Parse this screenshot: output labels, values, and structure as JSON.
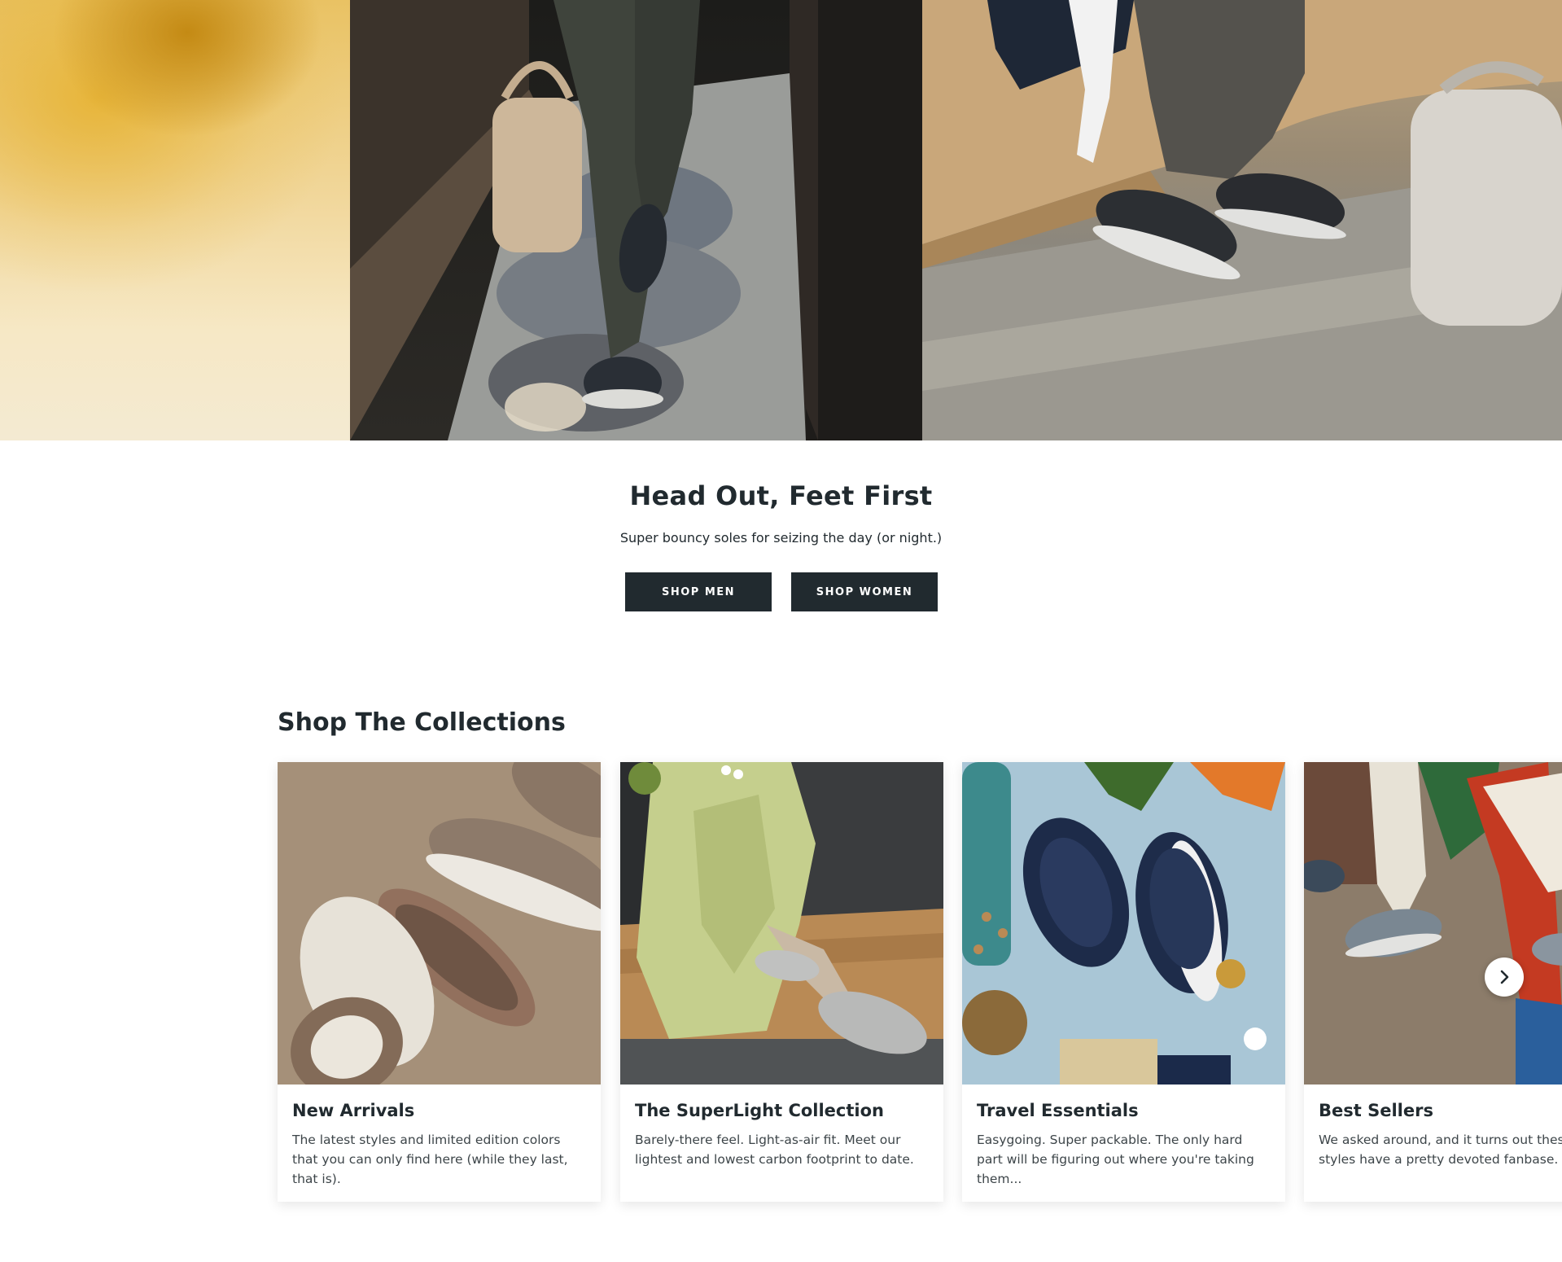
{
  "hero": {
    "panels": [
      "hero-image-left",
      "hero-image-walking",
      "hero-image-bench"
    ]
  },
  "promo": {
    "title": "Head Out, Feet First",
    "subtitle": "Super bouncy soles for seizing the day (or night.)",
    "shop_men_label": "SHOP MEN",
    "shop_women_label": "SHOP WOMEN"
  },
  "collections": {
    "heading": "Shop The Collections",
    "cards": [
      {
        "title": "New Arrivals",
        "description": "The latest styles and limited edition colors that you can only find here (while they last, that is)."
      },
      {
        "title": "The SuperLight Collection",
        "description": "Barely-there feel. Light-as-air fit. Meet our lightest and lowest carbon footprint to date."
      },
      {
        "title": "Travel Essentials",
        "description": "Easygoing. Super packable. The only hard part will be figuring out where you're taking them..."
      },
      {
        "title": "Best Sellers",
        "description": "We asked around, and it turns out these styles have a pretty devoted fanbase."
      }
    ],
    "next_icon": "chevron-right-icon"
  },
  "colors": {
    "primary": "#212a2f",
    "background": "#ffffff"
  }
}
